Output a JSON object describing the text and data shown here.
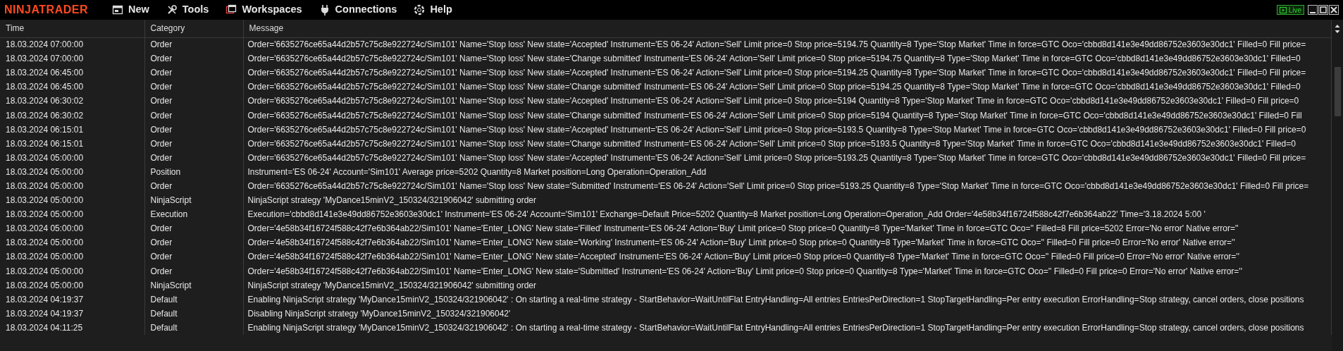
{
  "app": {
    "logo": "NINJATRADER",
    "live_label": "Live"
  },
  "menu": [
    {
      "label": "New"
    },
    {
      "label": "Tools"
    },
    {
      "label": "Workspaces"
    },
    {
      "label": "Connections"
    },
    {
      "label": "Help"
    }
  ],
  "table": {
    "columns": [
      "Time",
      "Category",
      "Message"
    ],
    "rows": [
      {
        "time": "18.03.2024 07:00:00",
        "category": "Order",
        "message": "Order='6635276ce65a44d2b57c75c8e922724c/Sim101' Name='Stop loss' New state='Accepted' Instrument='ES 06-24' Action='Sell' Limit price=0 Stop price=5194.75 Quantity=8 Type='Stop Market' Time in force=GTC Oco='cbbd8d141e3e49dd86752e3603e30dc1' Filled=0 Fill price="
      },
      {
        "time": "18.03.2024 07:00:00",
        "category": "Order",
        "message": "Order='6635276ce65a44d2b57c75c8e922724c/Sim101' Name='Stop loss' New state='Change submitted' Instrument='ES 06-24' Action='Sell' Limit price=0 Stop price=5194.75 Quantity=8 Type='Stop Market' Time in force=GTC Oco='cbbd8d141e3e49dd86752e3603e30dc1' Filled=0"
      },
      {
        "time": "18.03.2024 06:45:00",
        "category": "Order",
        "message": "Order='6635276ce65a44d2b57c75c8e922724c/Sim101' Name='Stop loss' New state='Accepted' Instrument='ES 06-24' Action='Sell' Limit price=0 Stop price=5194.25 Quantity=8 Type='Stop Market' Time in force=GTC Oco='cbbd8d141e3e49dd86752e3603e30dc1' Filled=0 Fill price="
      },
      {
        "time": "18.03.2024 06:45:00",
        "category": "Order",
        "message": "Order='6635276ce65a44d2b57c75c8e922724c/Sim101' Name='Stop loss' New state='Change submitted' Instrument='ES 06-24' Action='Sell' Limit price=0 Stop price=5194.25 Quantity=8 Type='Stop Market' Time in force=GTC Oco='cbbd8d141e3e49dd86752e3603e30dc1' Filled=0"
      },
      {
        "time": "18.03.2024 06:30:02",
        "category": "Order",
        "message": "Order='6635276ce65a44d2b57c75c8e922724c/Sim101' Name='Stop loss' New state='Accepted' Instrument='ES 06-24' Action='Sell' Limit price=0 Stop price=5194 Quantity=8 Type='Stop Market' Time in force=GTC Oco='cbbd8d141e3e49dd86752e3603e30dc1' Filled=0 Fill price=0"
      },
      {
        "time": "18.03.2024 06:30:02",
        "category": "Order",
        "message": "Order='6635276ce65a44d2b57c75c8e922724c/Sim101' Name='Stop loss' New state='Change submitted' Instrument='ES 06-24' Action='Sell' Limit price=0 Stop price=5194 Quantity=8 Type='Stop Market' Time in force=GTC Oco='cbbd8d141e3e49dd86752e3603e30dc1' Filled=0 Fill"
      },
      {
        "time": "18.03.2024 06:15:01",
        "category": "Order",
        "message": "Order='6635276ce65a44d2b57c75c8e922724c/Sim101' Name='Stop loss' New state='Accepted' Instrument='ES 06-24' Action='Sell' Limit price=0 Stop price=5193.5 Quantity=8 Type='Stop Market' Time in force=GTC Oco='cbbd8d141e3e49dd86752e3603e30dc1' Filled=0 Fill price=0"
      },
      {
        "time": "18.03.2024 06:15:01",
        "category": "Order",
        "message": "Order='6635276ce65a44d2b57c75c8e922724c/Sim101' Name='Stop loss' New state='Change submitted' Instrument='ES 06-24' Action='Sell' Limit price=0 Stop price=5193.5 Quantity=8 Type='Stop Market' Time in force=GTC Oco='cbbd8d141e3e49dd86752e3603e30dc1' Filled=0"
      },
      {
        "time": "18.03.2024 05:00:00",
        "category": "Order",
        "message": "Order='6635276ce65a44d2b57c75c8e922724c/Sim101' Name='Stop loss' New state='Accepted' Instrument='ES 06-24' Action='Sell' Limit price=0 Stop price=5193.25 Quantity=8 Type='Stop Market' Time in force=GTC Oco='cbbd8d141e3e49dd86752e3603e30dc1' Filled=0 Fill price="
      },
      {
        "time": "18.03.2024 05:00:00",
        "category": "Position",
        "message": "Instrument='ES 06-24' Account='Sim101' Average price=5202 Quantity=8 Market position=Long Operation=Operation_Add"
      },
      {
        "time": "18.03.2024 05:00:00",
        "category": "Order",
        "message": "Order='6635276ce65a44d2b57c75c8e922724c/Sim101' Name='Stop loss' New state='Submitted' Instrument='ES 06-24' Action='Sell' Limit price=0 Stop price=5193.25 Quantity=8 Type='Stop Market' Time in force=GTC Oco='cbbd8d141e3e49dd86752e3603e30dc1' Filled=0 Fill price="
      },
      {
        "time": "18.03.2024 05:00:00",
        "category": "NinjaScript",
        "message": "NinjaScript strategy 'MyDance15minV2_150324/321906042' submitting order"
      },
      {
        "time": "18.03.2024 05:00:00",
        "category": "Execution",
        "message": "Execution='cbbd8d141e3e49dd86752e3603e30dc1' Instrument='ES 06-24' Account='Sim101' Exchange=Default Price=5202 Quantity=8 Market position=Long Operation=Operation_Add Order='4e58b34f16724f588c42f7e6b364ab22' Time='3.18.2024 5:00 '"
      },
      {
        "time": "18.03.2024 05:00:00",
        "category": "Order",
        "message": "Order='4e58b34f16724f588c42f7e6b364ab22/Sim101' Name='Enter_LONG' New state='Filled' Instrument='ES 06-24' Action='Buy' Limit price=0 Stop price=0 Quantity=8 Type='Market' Time in force=GTC Oco='' Filled=8 Fill price=5202 Error='No error' Native error=''"
      },
      {
        "time": "18.03.2024 05:00:00",
        "category": "Order",
        "message": "Order='4e58b34f16724f588c42f7e6b364ab22/Sim101' Name='Enter_LONG' New state='Working' Instrument='ES 06-24' Action='Buy' Limit price=0 Stop price=0 Quantity=8 Type='Market' Time in force=GTC Oco='' Filled=0 Fill price=0 Error='No error' Native error=''"
      },
      {
        "time": "18.03.2024 05:00:00",
        "category": "Order",
        "message": "Order='4e58b34f16724f588c42f7e6b364ab22/Sim101' Name='Enter_LONG' New state='Accepted' Instrument='ES 06-24' Action='Buy' Limit price=0 Stop price=0 Quantity=8 Type='Market' Time in force=GTC Oco='' Filled=0 Fill price=0 Error='No error' Native error=''"
      },
      {
        "time": "18.03.2024 05:00:00",
        "category": "Order",
        "message": "Order='4e58b34f16724f588c42f7e6b364ab22/Sim101' Name='Enter_LONG' New state='Submitted' Instrument='ES 06-24' Action='Buy' Limit price=0 Stop price=0 Quantity=8 Type='Market' Time in force=GTC Oco='' Filled=0 Fill price=0 Error='No error' Native error=''"
      },
      {
        "time": "18.03.2024 05:00:00",
        "category": "NinjaScript",
        "message": "NinjaScript strategy 'MyDance15minV2_150324/321906042' submitting order"
      },
      {
        "time": "18.03.2024 04:19:37",
        "category": "Default",
        "message": "Enabling NinjaScript strategy 'MyDance15minV2_150324/321906042' : On starting a real-time strategy - StartBehavior=WaitUntilFlat EntryHandling=All entries EntriesPerDirection=1 StopTargetHandling=Per entry execution ErrorHandling=Stop strategy, cancel orders, close positions"
      },
      {
        "time": "18.03.2024 04:19:37",
        "category": "Default",
        "message": "Disabling NinjaScript strategy 'MyDance15minV2_150324/321906042'"
      },
      {
        "time": "18.03.2024 04:11:25",
        "category": "Default",
        "message": "Enabling NinjaScript strategy 'MyDance15minV2_150324/321906042' : On starting a real-time strategy - StartBehavior=WaitUntilFlat EntryHandling=All entries EntriesPerDirection=1 StopTargetHandling=Per entry execution ErrorHandling=Stop strategy, cancel orders, close positions"
      }
    ]
  }
}
